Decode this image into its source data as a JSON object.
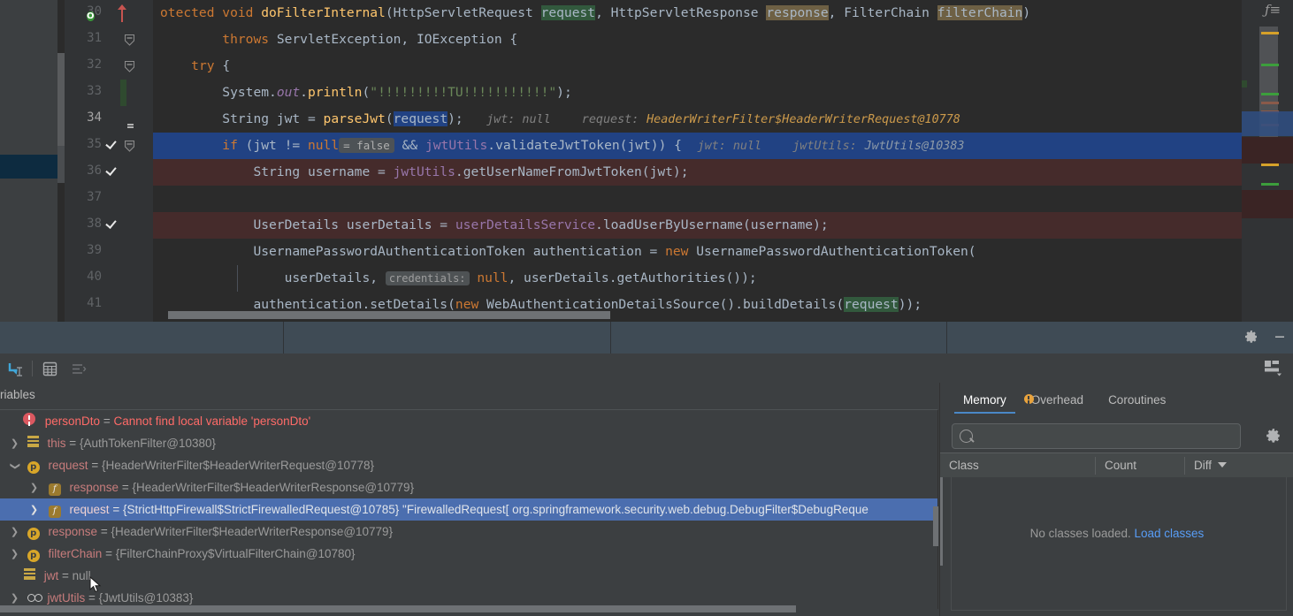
{
  "editor": {
    "lines": [
      {
        "num": "30",
        "current": false,
        "gutter": [
          "override-icon",
          "up-arrow-icon"
        ],
        "highlight": "none"
      },
      {
        "num": "31",
        "current": false,
        "gutter": [
          "fold-icon"
        ],
        "highlight": "none"
      },
      {
        "num": "32",
        "current": false,
        "gutter": [
          "fold-icon"
        ],
        "highlight": "none"
      },
      {
        "num": "33",
        "current": false,
        "gutter": [],
        "highlight": "none"
      },
      {
        "num": "34",
        "current": true,
        "gutter": [
          "lightbulb-icon"
        ],
        "highlight": "none"
      },
      {
        "num": "35",
        "current": false,
        "gutter": [
          "breakpoint-icon",
          "fold-icon"
        ],
        "highlight": "selected"
      },
      {
        "num": "36",
        "current": false,
        "gutter": [
          "breakpoint-icon"
        ],
        "highlight": "error"
      },
      {
        "num": "37",
        "current": false,
        "gutter": [],
        "highlight": "none"
      },
      {
        "num": "38",
        "current": false,
        "gutter": [
          "breakpoint-icon"
        ],
        "highlight": "error"
      },
      {
        "num": "39",
        "current": false,
        "gutter": [],
        "highlight": "none"
      },
      {
        "num": "40",
        "current": false,
        "gutter": [],
        "highlight": "none"
      },
      {
        "num": "41",
        "current": false,
        "gutter": [],
        "highlight": "none"
      }
    ],
    "code_text": {
      "l30": "otected void doFilterInternal(HttpServletRequest request, HttpServletResponse response, FilterChain filterChain)",
      "l31": "        throws ServletException, IOException {",
      "l32": "    try {",
      "l33": "        System.out.println(\"!!!!!!!!!TU!!!!!!!!!!!\");",
      "l34": "        String jwt = parseJwt(request);",
      "l34_hint_jwt": "jwt: null",
      "l34_hint_req_label": "request:",
      "l34_hint_req_value": "HeaderWriterFilter$HeaderWriterRequest@10778",
      "l35": "        if (jwt != null",
      "l35_chip": "= false",
      "l35_rest": " && jwtUtils.validateJwtToken(jwt)) {",
      "l35_hint_jwt": "jwt: null",
      "l35_hint_utils_label": "jwtUtils:",
      "l35_hint_utils_value": "JwtUtils@10383",
      "l36": "            String username = jwtUtils.getUserNameFromJwtToken(jwt);",
      "l37": "",
      "l38": "            UserDetails userDetails = userDetailsService.loadUserByUsername(username);",
      "l39": "            UsernamePasswordAuthenticationToken authentication = new UsernamePasswordAuthenticationToken(",
      "l40_a": "                userDetails, ",
      "l40_chip": "credentials:",
      "l40_b": " null, userDetails.getAuthorities());",
      "l41": "            authentication.setDetails(new WebAuthenticationDetailsSource().buildDetails(request));"
    },
    "scrollbar": {
      "stripes_present": true
    },
    "right_gutter_icon": "fold-function-icon"
  },
  "debug_window": {
    "tabbar": {
      "dividers": [
        320,
        690,
        1070
      ],
      "gear_label": "gear-icon",
      "minimize_label": "minimize-icon"
    },
    "toolbar": {
      "items": [
        {
          "name": "evaluate-expression-icon",
          "label": "evaluate-expression"
        },
        {
          "name": "view-as-table-icon",
          "label": "view-as-table"
        },
        {
          "name": "sort-values-icon",
          "label": "sort-values"
        }
      ],
      "layout_button": "layout-settings-icon"
    },
    "variables": {
      "header": "riables",
      "rows": [
        {
          "indent": 0,
          "arrow": "",
          "icon": "error-icon",
          "name": "personDto",
          "eq": " = ",
          "value": "Cannot find local variable 'personDto'",
          "value_style": "error",
          "selected": false
        },
        {
          "indent": 0,
          "arrow": "collapsed",
          "icon": "local-icon",
          "name": "this",
          "eq": " = ",
          "value": "{AuthTokenFilter@10380}",
          "value_style": "normal",
          "selected": false
        },
        {
          "indent": 0,
          "arrow": "expanded",
          "icon": "param-icon",
          "name": "request",
          "eq": " = ",
          "value": "{HeaderWriterFilter$HeaderWriterRequest@10778}",
          "value_style": "normal",
          "selected": false
        },
        {
          "indent": 1,
          "arrow": "collapsed",
          "icon": "field-icon",
          "name": "response",
          "eq": " = ",
          "value": "{HeaderWriterFilter$HeaderWriterResponse@10779}",
          "value_style": "normal",
          "selected": false
        },
        {
          "indent": 1,
          "arrow": "collapsed",
          "icon": "field-icon",
          "name": "request",
          "eq": " = ",
          "value": "{StrictHttpFirewall$StrictFirewalledRequest@10785} \"FirewalledRequest[ org.springframework.security.web.debug.DebugFilter$DebugReque",
          "value_style": "normal",
          "selected": true
        },
        {
          "indent": 0,
          "arrow": "collapsed",
          "icon": "param-icon",
          "name": "response",
          "eq": " = ",
          "value": "{HeaderWriterFilter$HeaderWriterResponse@10779}",
          "value_style": "normal",
          "selected": false
        },
        {
          "indent": 0,
          "arrow": "collapsed",
          "icon": "param-icon",
          "name": "filterChain",
          "eq": " = ",
          "value": "{FilterChainProxy$VirtualFilterChain@10780}",
          "value_style": "normal",
          "selected": false
        },
        {
          "indent": 0,
          "arrow": "",
          "icon": "local-icon",
          "name": "jwt",
          "eq": " = ",
          "value": "null",
          "value_style": "normal",
          "selected": false
        },
        {
          "indent": 0,
          "arrow": "collapsed",
          "icon": "static-icon",
          "name": "jwtUtils",
          "eq": " = ",
          "value": "{JwtUtils@10383}",
          "value_style": "normal",
          "selected": false
        }
      ]
    },
    "memory": {
      "tabs": [
        {
          "label": "Memory",
          "active": true,
          "warn": false
        },
        {
          "label": "Overhead",
          "active": false,
          "warn": true
        },
        {
          "label": "Coroutines",
          "active": false,
          "warn": false
        }
      ],
      "search": {
        "value": "",
        "placeholder": ""
      },
      "gear": "gear-icon",
      "columns": [
        {
          "label": "Class",
          "sort": false
        },
        {
          "label": "Count",
          "sort": false
        },
        {
          "label": "Diff",
          "sort": true
        }
      ],
      "empty_text": "No classes loaded. ",
      "empty_link": "Load classes"
    }
  },
  "colors": {
    "editor_bg": "#2b2b2b",
    "panel_bg": "#3c3f41",
    "selection": "#214283",
    "tree_selection": "#4b6eaf",
    "error_line": "#452b2b",
    "keyword": "#cc7832",
    "method": "#ffc66d",
    "field": "#9876aa",
    "string": "#6a8759",
    "link": "#589df6",
    "error_text": "#ff6b68",
    "tabbar": "#3f4b55"
  }
}
